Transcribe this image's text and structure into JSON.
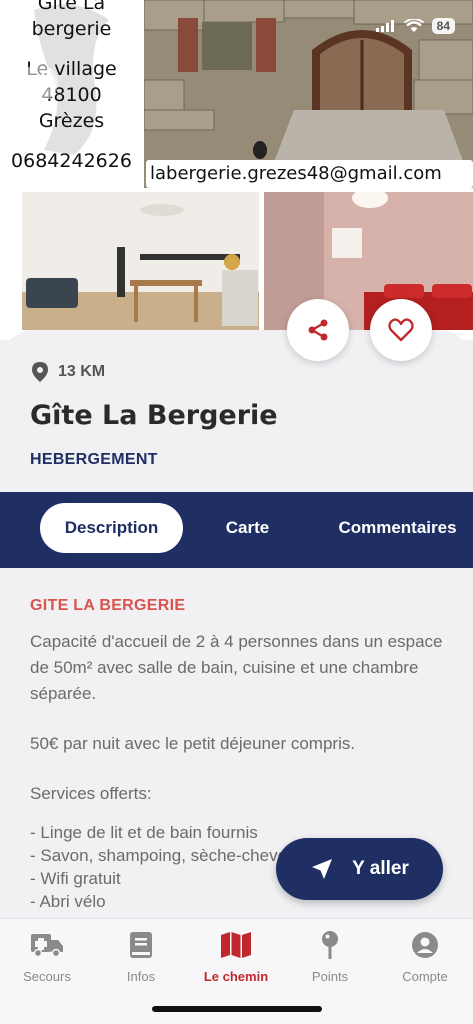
{
  "status_bar": {
    "battery": "84"
  },
  "gallery": {
    "poster_lines": [
      "Gîte La",
      "bergerie",
      "Le village",
      "48100",
      "Grèzes",
      "0684242626"
    ],
    "email": "labergerie.grezes48@gmail.com"
  },
  "place": {
    "distance": "13 KM",
    "title": "Gîte La Bergerie",
    "category": "HEBERGEMENT"
  },
  "tabs": [
    {
      "label": "Description"
    },
    {
      "label": "Carte"
    },
    {
      "label": "Commentaires"
    }
  ],
  "description": {
    "heading": "GITE LA BERGERIE",
    "capacity": "Capacité d'accueil de 2 à 4 personnes dans un espace de 50m² avec salle de bain, cuisine et une chambre séparée.",
    "price": "50€ par nuit avec le petit déjeuner compris.",
    "services_title": "Services offerts:",
    "services": [
      "- Linge de lit et de bain fournis",
      "- Savon, shampoing, sèche-cheveux",
      "- Wifi gratuit",
      "- Abri vélo"
    ]
  },
  "go_button": {
    "label": "Y aller"
  },
  "nav": [
    {
      "label": "Secours"
    },
    {
      "label": "Infos"
    },
    {
      "label": "Le chemin"
    },
    {
      "label": "Points"
    },
    {
      "label": "Compte"
    }
  ],
  "colors": {
    "navy": "#1f2f63",
    "red": "#c0282d",
    "accent_heading": "#d9534f"
  }
}
